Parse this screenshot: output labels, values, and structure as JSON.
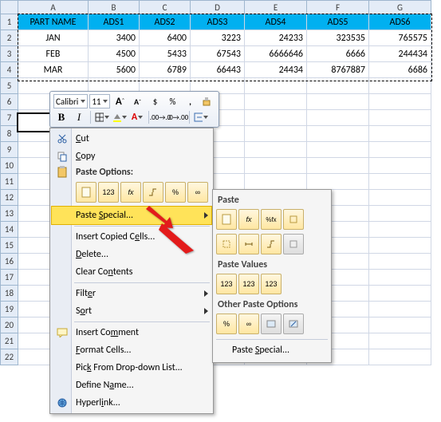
{
  "columns": [
    "A",
    "B",
    "C",
    "D",
    "E",
    "F",
    "G"
  ],
  "row_count": 22,
  "header_row": {
    "A": "PART NAME",
    "B": "ADS1",
    "C": "ADS2",
    "D": "ADS3",
    "E": "ADS4",
    "F": "ADS5",
    "G": "ADS6"
  },
  "data_rows": [
    {
      "A": "JAN",
      "B": "3400",
      "C": "6400",
      "D": "3223",
      "E": "24233",
      "F": "323535",
      "G": "765575"
    },
    {
      "A": "FEB",
      "B": "4500",
      "C": "5433",
      "D": "67543",
      "E": "6666646",
      "F": "6666",
      "G": "244434"
    },
    {
      "A": "MAR",
      "B": "5600",
      "C": "6789",
      "D": "66443",
      "E": "24434",
      "F": "8767887",
      "G": "6686"
    }
  ],
  "marquee": {
    "from": "A1",
    "to": "G4"
  },
  "active_cell": "A7",
  "minitoolbar": {
    "font": "Calibri",
    "size": "11",
    "grow": "A",
    "shrink": "A",
    "dollar": "$",
    "percent": "%",
    "comma": ",",
    "bold": "B",
    "italic": "I"
  },
  "context_menu": {
    "cut": "Cut",
    "copy": "Copy",
    "paste_options_hdr": "Paste Options:",
    "paste_special": "Paste Special...",
    "insert": "Insert Copied Cells...",
    "delete": "Delete...",
    "clear": "Clear Contents",
    "filter": "Filter",
    "sort": "Sort",
    "comment": "Insert Comment",
    "format": "Format Cells...",
    "pick": "Pick From Drop-down List...",
    "define": "Define Name...",
    "hyperlink": "Hyperlink...",
    "opt_labels": [
      "",
      "123",
      "fx",
      "",
      "%",
      "⟳"
    ]
  },
  "submenu": {
    "paste_hdr": "Paste",
    "paste_values_hdr": "Paste Values",
    "other_hdr": "Other Paste Options",
    "paste_special_btn": "Paste Special...",
    "row1": [
      "",
      "fx",
      "%fx",
      ""
    ],
    "row2": [
      "",
      "",
      "",
      ""
    ],
    "vals": [
      "123",
      "123",
      "123"
    ],
    "other": [
      "%",
      "",
      "",
      "⟳"
    ]
  },
  "chart_data": {
    "type": "table",
    "title": "",
    "columns": [
      "PART NAME",
      "ADS1",
      "ADS2",
      "ADS3",
      "ADS4",
      "ADS5",
      "ADS6"
    ],
    "rows": [
      [
        "JAN",
        3400,
        6400,
        3223,
        24233,
        323535,
        765575
      ],
      [
        "FEB",
        4500,
        5433,
        67543,
        6666646,
        6666,
        244434
      ],
      [
        "MAR",
        5600,
        6789,
        66443,
        24434,
        8767887,
        6686
      ]
    ]
  }
}
